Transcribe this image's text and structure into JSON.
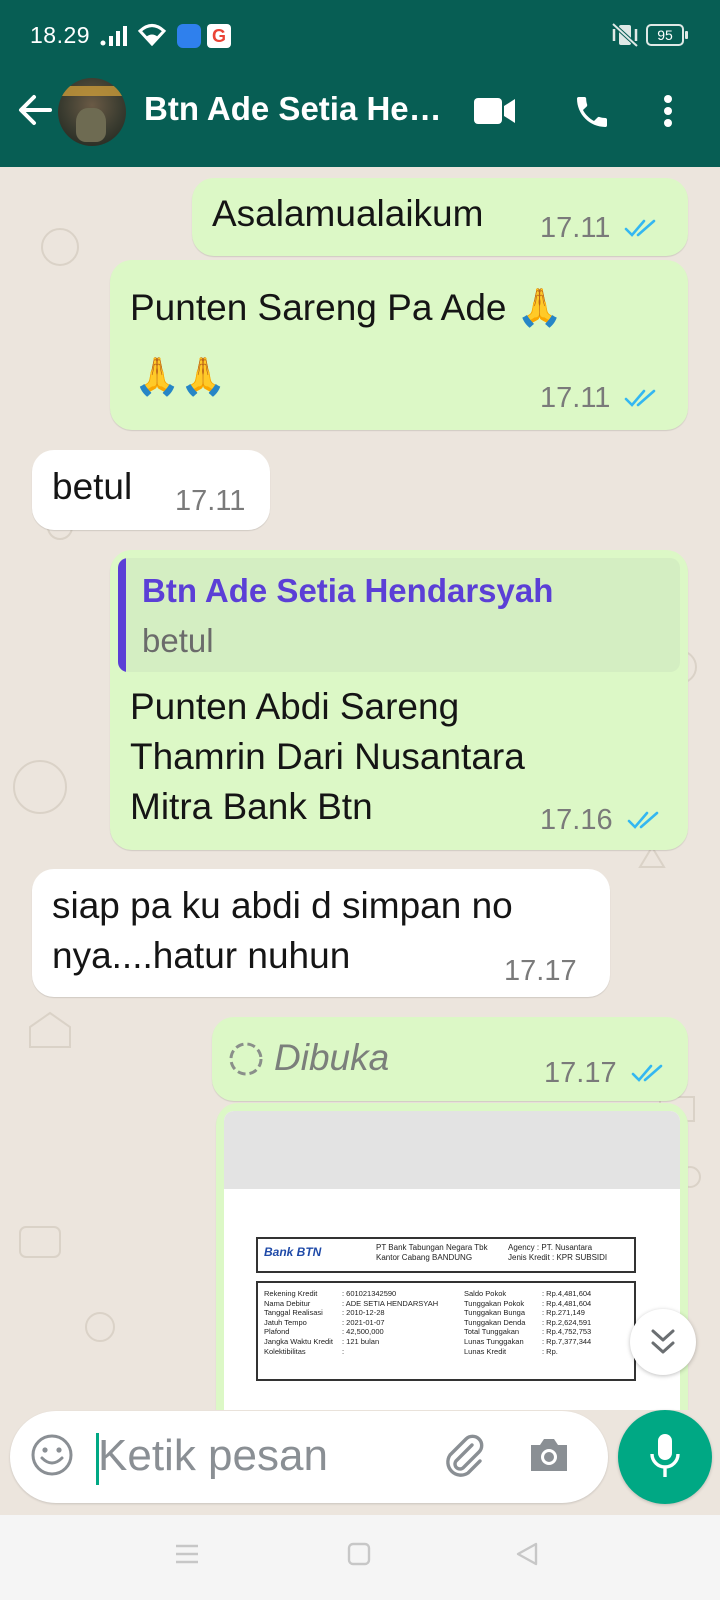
{
  "status_bar": {
    "time": "18.29",
    "app_badge": "G",
    "battery": "95"
  },
  "header": {
    "contact_name": "Btn Ade Setia He…",
    "icons": [
      "back-arrow-icon",
      "video-call-icon",
      "voice-call-icon",
      "more-options-icon"
    ]
  },
  "messages": [
    {
      "type": "outgoing",
      "text": "Asalamualaikum",
      "time": "17.11",
      "status": "read"
    },
    {
      "type": "outgoing",
      "text_line1": "Punten Sareng Pa Ade 🙏",
      "text_line2": "🙏🙏",
      "time": "17.11",
      "status": "read"
    },
    {
      "type": "incoming",
      "text": "betul",
      "time": "17.11"
    },
    {
      "type": "outgoing",
      "reply": {
        "name": "Btn Ade Setia Hendarsyah",
        "text": "betul"
      },
      "text_line1": "Punten Abdi Sareng",
      "text_line2": "Thamrin Dari Nusantara",
      "text_line3": "Mitra Bank Btn",
      "time": "17.16",
      "status": "read"
    },
    {
      "type": "incoming",
      "text_line1": "siap pa ku abdi d simpan no",
      "text_line2": "nya....hatur nuhun",
      "time": "17.17"
    },
    {
      "type": "outgoing",
      "text": "Dibuka",
      "time": "17.17",
      "status": "read"
    },
    {
      "type": "outgoing-image",
      "document": {
        "bank_logo": "Bank BTN",
        "bank_name": "PT Bank Tabungan Negara Tbk",
        "branch": "Kantor Cabang BANDUNG",
        "agency": "Agency : PT. Nusantara",
        "credit_type": "Jenis Kredit : KPR SUBSIDI",
        "left_labels": [
          "Rekening Kredit",
          "Nama Debitur",
          "Tanggal Realisasi",
          "Jatuh Tempo",
          "Plafond",
          "Jangka Waktu Kredit",
          "Kolektibilitas"
        ],
        "left_values": [
          ": 601021342590",
          ": ADE SETIA HENDARSYAH",
          ": 2010-12-28",
          ": 2021-01-07",
          ": 42,500,000",
          ": 121 bulan",
          ":"
        ],
        "right_labels": [
          "Saldo Pokok",
          "Tunggakan Pokok",
          "Tunggakan Bunga",
          "Tunggakan Denda",
          "Total Tunggakan",
          "Lunas Tunggakan",
          "Lunas Kredit"
        ],
        "right_values": [
          ": Rp.4,481,604",
          ": Rp.4,481,604",
          ": Rp.271,149",
          ": Rp.2,624,591",
          ": Rp.4,752,753",
          ": Rp.7,377,344",
          ": Rp."
        ]
      }
    }
  ],
  "composer": {
    "placeholder": "Ketik pesan"
  },
  "colors": {
    "header": "#075e54",
    "outgoing_bubble": "#dcf8c6",
    "incoming_bubble": "#ffffff",
    "read_tick": "#34b7f1",
    "accent": "#00a884",
    "quote_accent": "#5b3fd6"
  }
}
